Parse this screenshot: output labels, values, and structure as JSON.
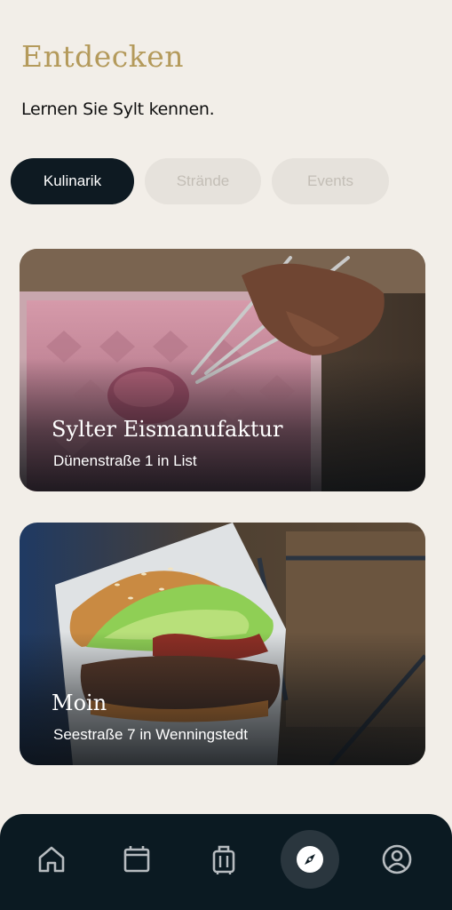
{
  "header": {
    "title": "Entdecken",
    "subtitle": "Lernen Sie Sylt kennen."
  },
  "tabs": [
    {
      "label": "Kulinarik",
      "active": true
    },
    {
      "label": "Strände",
      "active": false
    },
    {
      "label": "Events",
      "active": false
    }
  ],
  "cards": [
    {
      "name": "Sylter Eismanufaktur",
      "address": "Dünenstraße 1 in List"
    },
    {
      "name": "Moin",
      "address": "Seestraße 7 in Wenningstedt"
    }
  ],
  "nav": {
    "items": [
      {
        "icon": "home-icon",
        "active": false
      },
      {
        "icon": "calendar-icon",
        "active": false
      },
      {
        "icon": "luggage-icon",
        "active": false
      },
      {
        "icon": "compass-icon",
        "active": true
      },
      {
        "icon": "profile-icon",
        "active": false
      }
    ]
  },
  "colors": {
    "background": "#f2eee8",
    "title": "#b49a5b",
    "active_tab": "#0e1a22",
    "inactive_tab": "#e6e2dc",
    "navbar": "#0b1a22"
  }
}
